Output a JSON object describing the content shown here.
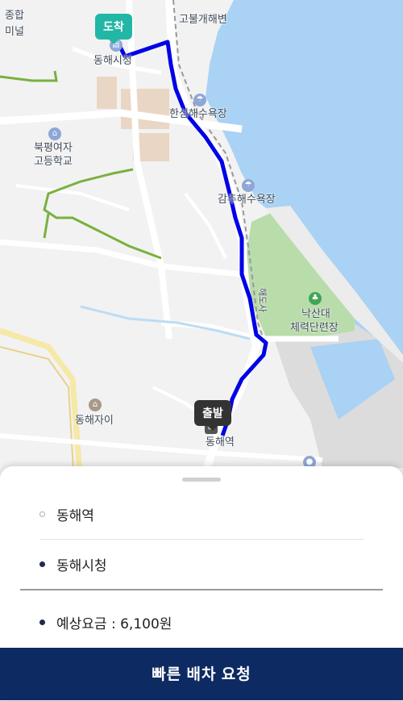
{
  "map": {
    "labels": {
      "jonghap": "종합",
      "terminal": "미널",
      "gobul_beach": "고불개해변",
      "donghae_city": "동해시청",
      "hansum_beach": "한섬해수욕장",
      "bukpyeong_school_1": "북평여자",
      "bukpyeong_school_2": "고등학교",
      "gamchu_beach": "감추해수욕장",
      "nakssan_1": "낙산대",
      "nakssan_2": "체력단련장",
      "donghae_xi": "동해자이",
      "donghae_station": "동해역",
      "road_name": "해도사"
    },
    "markers": {
      "arrival": "도착",
      "departure": "출발"
    },
    "route_color": "#0000e6"
  },
  "sheet": {
    "origin": "동해역",
    "destination": "동해시청",
    "fare_label": "예상요금 : 6,100원"
  },
  "cta": {
    "label": "빠른 배차 요청"
  }
}
